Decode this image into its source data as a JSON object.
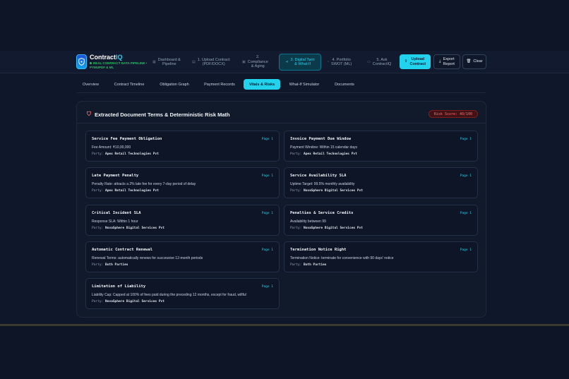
{
  "header": {
    "brand_main": "Contract",
    "brand_accent": "IQ",
    "pipeline_line1": "REAL CONTRACT DATA PIPELINE •",
    "pipeline_line2": "PYMUPDF & ML",
    "tabs": [
      {
        "label1": "Dashboard &",
        "label2": "Pipeline",
        "icon": "grid-icon"
      },
      {
        "label1": "1. Upload Contract",
        "label2": "(PDF/DOCX)",
        "icon": "file-icon"
      },
      {
        "label1": "2.",
        "label2": "Compliance",
        "label3": "& Aging",
        "icon": "calendar-icon"
      },
      {
        "label1": "3. Digital Twin",
        "label2": "& What-If",
        "icon": "share-icon"
      },
      {
        "label1": "4. Portfolio",
        "label2": "SWOT (ML)",
        "icon": "pie-icon"
      },
      {
        "label1": "5. Ask",
        "label2": "ContractIQ",
        "icon": "chat-icon"
      }
    ],
    "upload_label1": "Upload",
    "upload_label2": "Contract",
    "export_label1": "Export",
    "export_label2": "Report",
    "clear_label": "Clear"
  },
  "subtabs": [
    "Overview",
    "Contract Timeline",
    "Obligation Graph",
    "Payment Records",
    "Vitals & Risks",
    "What-If Simulator",
    "Documents"
  ],
  "panel": {
    "title": "Extracted Document Terms & Deterministic Risk Math",
    "risk_score": "Risk Score: 40/100"
  },
  "cards": [
    {
      "title": "Service Fee Payment Obligation",
      "page": "Page 1",
      "desc": "Fee Amount: ₹10,00,000",
      "party_label": "Party:",
      "party": "Apex Retail Technologies Pvt"
    },
    {
      "title": "Invoice Payment Due Window",
      "page": "Page 1",
      "desc": "Payment Window: Within 15 calendar days",
      "party_label": "Party:",
      "party": "Apex Retail Technologies Pvt"
    },
    {
      "title": "Late Payment Penalty",
      "page": "Page 1",
      "desc": "Penalty Rate: attracts a 2% late fee for every 7-day period of delay",
      "party_label": "Party:",
      "party": "Apex Retail Technologies Pvt"
    },
    {
      "title": "Service Availability SLA",
      "page": "Page 1",
      "desc": "Uptime Target: 99.5% monthly availability",
      "party_label": "Party:",
      "party": "NovaSphere Digital Services Pvt"
    },
    {
      "title": "Critical Incident SLA",
      "page": "Page 1",
      "desc": "Response SLA: Within 1 hour",
      "party_label": "Party:",
      "party": "NovaSphere Digital Services Pvt"
    },
    {
      "title": "Penalties & Service Credits",
      "page": "Page 1",
      "desc": "Availability between 99",
      "party_label": "Party:",
      "party": "NovaSphere Digital Services Pvt"
    },
    {
      "title": "Automatic Contract Renewal",
      "page": "Page 1",
      "desc": "Renewal Terms: automatically renews for successive 12-month periods",
      "party_label": "Party:",
      "party": "Both Parties"
    },
    {
      "title": "Termination Notice Right",
      "page": "Page 1",
      "desc": "Termination Notice: terminate for convenience with 90 days' notice",
      "party_label": "Party:",
      "party": "Both Parties"
    },
    {
      "title": "Limitation of Liability",
      "page": "Page 1",
      "desc": "Liability Cap: Capped at 100% of fees paid during the preceding 12 months, except for fraud, willful",
      "party_label": "Party:",
      "party": "NovaSphere Digital Services Pvt"
    }
  ]
}
